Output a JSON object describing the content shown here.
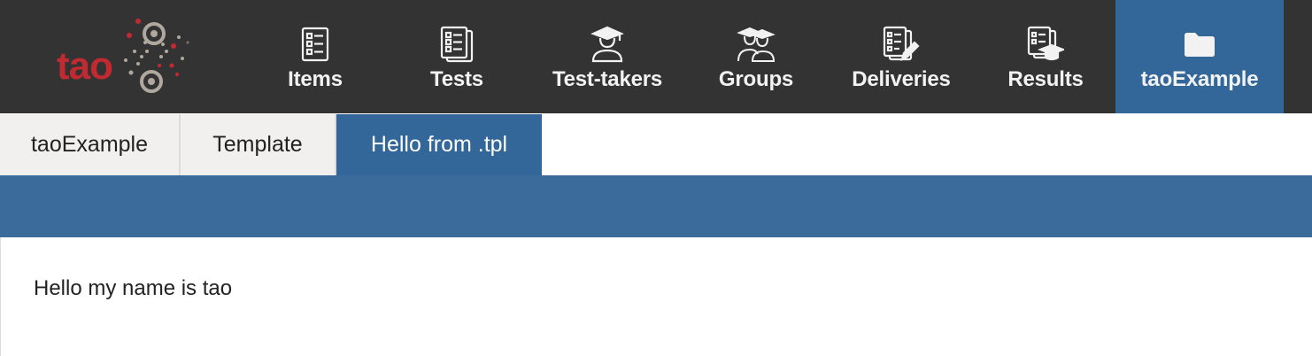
{
  "logo": {
    "text": "tao"
  },
  "nav": {
    "items": [
      {
        "label": "Items",
        "icon": "items-icon"
      },
      {
        "label": "Tests",
        "icon": "tests-icon"
      },
      {
        "label": "Test-takers",
        "icon": "test-taker-icon"
      },
      {
        "label": "Groups",
        "icon": "groups-icon"
      },
      {
        "label": "Deliveries",
        "icon": "deliveries-icon"
      },
      {
        "label": "Results",
        "icon": "results-icon"
      },
      {
        "label": "taoExample",
        "icon": "folder-icon",
        "active": true
      }
    ]
  },
  "tabs": [
    {
      "label": "taoExample"
    },
    {
      "label": "Template"
    },
    {
      "label": "Hello from .tpl",
      "active": true
    }
  ],
  "content": {
    "message": "Hello my name is tao"
  },
  "colors": {
    "topbar": "#333333",
    "accent": "#336699",
    "band": "#3a6b9b",
    "brand": "#c22a31"
  }
}
